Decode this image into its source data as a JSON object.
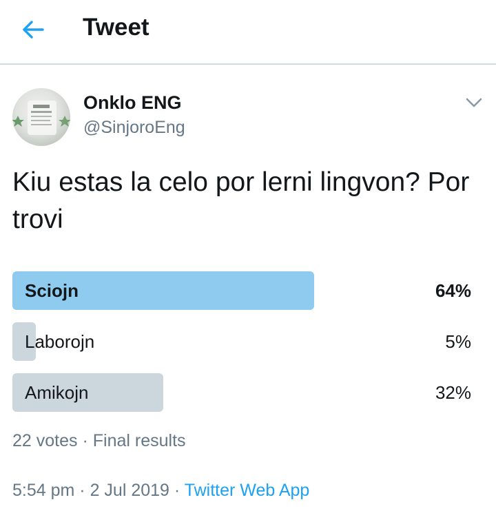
{
  "header": {
    "title": "Tweet",
    "back_icon": "arrow-left-icon",
    "accent": "#1da1f2"
  },
  "author": {
    "display_name": "Onklo ENG",
    "handle": "@SinjoroEng",
    "avatar_icon": "avatar-image"
  },
  "tweet": {
    "text": "Kiu estas la celo por lerni lingvon? Por trovi"
  },
  "poll": {
    "options": [
      {
        "label": "Sciojn",
        "percent_label": "64%",
        "percent": 64,
        "winner": true
      },
      {
        "label": "Laborojn",
        "percent_label": "5%",
        "percent": 5,
        "winner": false
      },
      {
        "label": "Amikojn",
        "percent_label": "32%",
        "percent": 32,
        "winner": false
      }
    ],
    "winner_color": "#8ecbee",
    "other_color": "#ccd6dd",
    "votes": "22 votes",
    "separator": "·",
    "status": "Final results"
  },
  "meta": {
    "time": "5:54 pm",
    "date": "2 Jul 2019",
    "separator": "·",
    "source": "Twitter Web App"
  }
}
